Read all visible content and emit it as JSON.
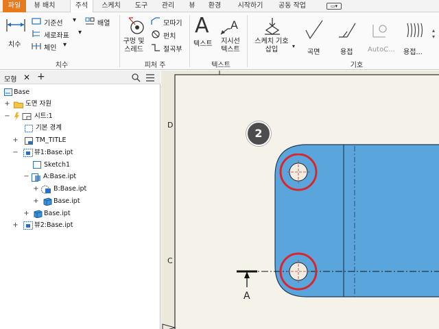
{
  "tabs": [
    "파일",
    "뷰 배치",
    "주석",
    "스케치",
    "도구",
    "관리",
    "뷰",
    "환경",
    "시작하기",
    "공동 작업"
  ],
  "ribbon": {
    "dimension_group": {
      "title": "치수",
      "dimension_label": "치수",
      "baseline_label": "기준선",
      "ordinate_label": "세로좌표",
      "chain_label": "체인",
      "arrange_label": "배열"
    },
    "feature_notes_group": {
      "title": "피처 주",
      "hole_thread_label": "구멍 및\n스레드",
      "chamfer_label": "모따기",
      "punch_label": "펀치",
      "bend_label": "절곡부"
    },
    "text_group": {
      "title": "텍스트",
      "text_label": "텍스트",
      "leader_text_label": "지시선\n텍스트"
    },
    "symbols_group": {
      "title": "기호",
      "sketch_symbol_label": "스케치 기호\n삽입",
      "surface_label": "곡면",
      "weld_label": "용접",
      "autocad_label": "AutoC...",
      "weld2_label": "용접..."
    }
  },
  "browser": {
    "tab_label": "모형",
    "add_label": "+",
    "tree": [
      {
        "label": "Base",
        "level": 0,
        "expander": "",
        "icon": "drawing-icon"
      },
      {
        "label": "도면 자원",
        "level": 1,
        "expander": "+",
        "icon": "folder-icon"
      },
      {
        "label": "시트:1",
        "level": 1,
        "expander": "−",
        "icon": "sheet-icon"
      },
      {
        "label": "기본 경계",
        "level": 2,
        "expander": "",
        "icon": "border-icon"
      },
      {
        "label": "TM_TITLE",
        "level": 2,
        "expander": "+",
        "icon": "titleblock-icon"
      },
      {
        "label": "뷰1:Base.ipt",
        "level": 2,
        "expander": "−",
        "icon": "view-icon"
      },
      {
        "label": "Sketch1",
        "level": 3,
        "expander": "",
        "icon": "sketch-icon"
      },
      {
        "label": "A:Base.ipt",
        "level": 3,
        "expander": "−",
        "icon": "section-view-icon"
      },
      {
        "label": "B:Base.ipt",
        "level": 4,
        "expander": "+",
        "icon": "detail-view-icon"
      },
      {
        "label": "Base.ipt",
        "level": 4,
        "expander": "+",
        "icon": "part-icon"
      },
      {
        "label": "Base.ipt",
        "level": 3,
        "expander": "+",
        "icon": "part-icon"
      },
      {
        "label": "뷰2:Base.ipt",
        "level": 2,
        "expander": "+",
        "icon": "view-icon"
      }
    ]
  },
  "canvas": {
    "zone_d": "D",
    "zone_c": "C",
    "step_badge": "2",
    "section_label": "A"
  },
  "colors": {
    "file_tab": "#e87a1e",
    "part_fill": "#5aa6dc",
    "highlight_ring": "#d9262b",
    "badge": "#4d4d4d"
  }
}
